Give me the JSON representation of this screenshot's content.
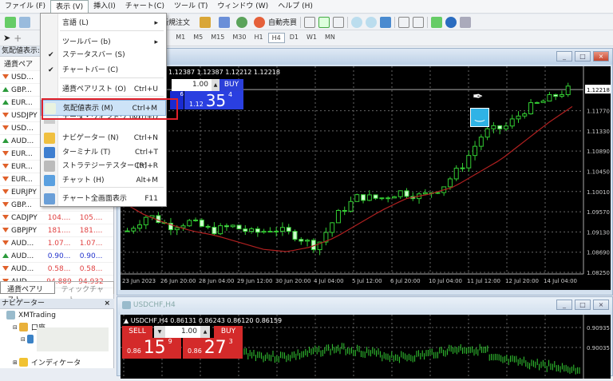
{
  "menubar": [
    "ファイル (F)",
    "表示 (V)",
    "挿入(I)",
    "チャート(C)",
    "ツール (T)",
    "ウィンドウ (W)",
    "ヘルプ (H)"
  ],
  "toolbar": {
    "new_order": "新規注文",
    "auto_trade": "自動売買",
    "timeframes": [
      "M1",
      "M5",
      "M15",
      "M30",
      "H1",
      "H4",
      "D1",
      "W1",
      "MN"
    ],
    "active_timeframe": "H4"
  },
  "view_menu": {
    "items": [
      {
        "label": "言語 (L)",
        "shortcut": "",
        "submenu": true
      },
      {
        "label": "ツールバー (b)",
        "shortcut": "",
        "submenu": true
      },
      {
        "label": "ステータスバー (S)",
        "checked": true
      },
      {
        "label": "チャートバー (C)",
        "checked": true
      },
      {
        "label": "通貨ペアリスト (O)",
        "shortcut": "Ctrl+U"
      },
      {
        "label": "気配値表示 (M)",
        "shortcut": "Ctrl+M",
        "highlighted": true
      },
      {
        "label": "データ・ウィンドウ (D)",
        "shortcut": "Ctrl+D"
      },
      {
        "label": "ナビゲーター (N)",
        "shortcut": "Ctrl+N"
      },
      {
        "label": "ターミナル (T)",
        "shortcut": "Ctrl+T"
      },
      {
        "label": "ストラテジーテスター (R)",
        "shortcut": "Ctrl+R"
      },
      {
        "label": "チャット (H)",
        "shortcut": "Alt+M"
      },
      {
        "label": "チャート全画面表示",
        "shortcut": "F11"
      }
    ]
  },
  "market_watch": {
    "title": "気配値表示: ",
    "col_symbol": "通貨ペア",
    "rows": [
      {
        "s": "USD...",
        "dir": "down",
        "bid": "",
        "ask": ""
      },
      {
        "s": "GBP...",
        "dir": "up",
        "bid": "",
        "ask": ""
      },
      {
        "s": "EUR...",
        "dir": "up",
        "bid": "",
        "ask": ""
      },
      {
        "s": "USDJPY",
        "dir": "down",
        "bid": "",
        "ask": ""
      },
      {
        "s": "USD...",
        "dir": "down",
        "bid": "",
        "ask": ""
      },
      {
        "s": "AUD...",
        "dir": "up",
        "bid": "",
        "ask": ""
      },
      {
        "s": "EUR...",
        "dir": "down",
        "bid": "",
        "ask": ""
      },
      {
        "s": "EUR...",
        "dir": "down",
        "bid": "",
        "ask": ""
      },
      {
        "s": "EUR...",
        "dir": "down",
        "bid": "",
        "ask": ""
      },
      {
        "s": "EURJPY",
        "dir": "down",
        "bid": "",
        "ask": ""
      },
      {
        "s": "GBP...",
        "dir": "down",
        "bid": "",
        "ask": ""
      },
      {
        "s": "CADJPY",
        "dir": "down",
        "bid": "104....",
        "ask": "105...."
      },
      {
        "s": "GBPJPY",
        "dir": "down",
        "bid": "181....",
        "ask": "181...."
      },
      {
        "s": "AUD...",
        "dir": "down",
        "bid": "1.07...",
        "ask": "1.07..."
      },
      {
        "s": "AUD...",
        "dir": "up",
        "bid": "0.90...",
        "ask": "0.90..."
      },
      {
        "s": "AUD...",
        "dir": "down",
        "bid": "0.58...",
        "ask": "0.58..."
      },
      {
        "s": "AUD...",
        "dir": "down",
        "bid": "94.889",
        "ask": "94.932"
      }
    ],
    "tabs": [
      "通貨ペアリスト",
      "ティックチャート"
    ]
  },
  "navigator": {
    "title": "ナビゲーター",
    "close": "×",
    "items": [
      "XMTrading",
      "口座",
      "インディケータ"
    ]
  },
  "chart1": {
    "title": "4",
    "ohlc": "1.12387 1.12387 1.12212 1.12218",
    "lot": "1.00",
    "buy": "BUY",
    "buy_prefix": "1.12",
    "buy_big": "35",
    "buy_sup": "4",
    "sell_sup": "6",
    "price_labels": [
      "1.12218",
      "1.11770",
      "1.11330",
      "1.10890",
      "1.10450",
      "1.10010",
      "1.09570",
      "1.09130",
      "1.08690",
      "1.08250"
    ],
    "time_labels": [
      "23 Jun 2023",
      "26 Jun 20:00",
      "28 Jun 04:00",
      "29 Jun 12:00",
      "30 Jun 20:00",
      "4 Jul 04:00",
      "5 Jul 12:00",
      "6 Jul 20:00",
      "10 Jul 04:00",
      "11 Jul 12:00",
      "12 Jul 20:00",
      "14 Jul 04:00"
    ],
    "price_path": [
      1.0915,
      1.095,
      1.0925,
      1.0935,
      1.0915,
      1.0925,
      1.091,
      1.092,
      1.0905,
      1.088,
      1.095,
      1.099,
      1.0985,
      1.1,
      1.099,
      1.101,
      1.106,
      1.113,
      1.114,
      1.118,
      1.12,
      1.1222
    ],
    "ma_path": [
      1.098,
      1.095,
      1.093,
      1.0915,
      1.0905,
      1.089,
      1.0875,
      1.087,
      1.088,
      1.09,
      1.093,
      1.096,
      1.0985,
      1.0995,
      1.101,
      1.104,
      1.107,
      1.111,
      1.115,
      1.1185
    ]
  },
  "chart2": {
    "title": "USDCHF,H4",
    "ohlc": "USDCHF,H4  0.86131 0.86243 0.86120 0.86159",
    "sell": "SELL",
    "buy": "BUY",
    "lot": "1.00",
    "sell_prefix": "0.86",
    "sell_big": "15",
    "sell_sup": "9",
    "buy_prefix": "0.86",
    "buy_big": "27",
    "buy_sup": "3",
    "price_labels": [
      "0.90935",
      "0.90035"
    ]
  }
}
